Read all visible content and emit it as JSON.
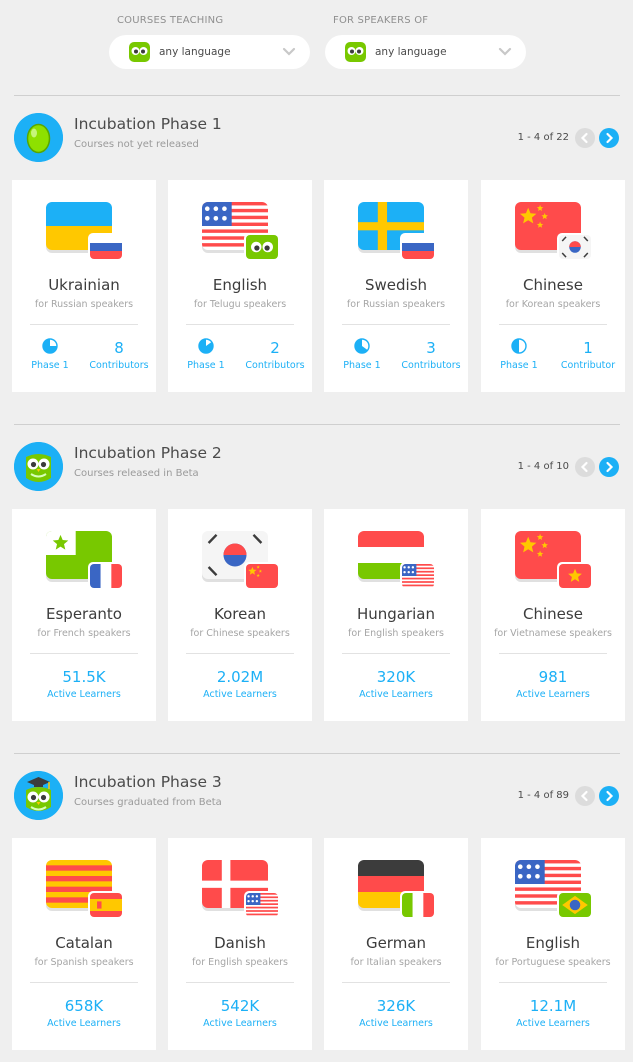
{
  "filters": {
    "teaching": {
      "label": "COURSES TEACHING",
      "value": "any language"
    },
    "speakers": {
      "label": "FOR SPEAKERS OF",
      "value": "any language"
    }
  },
  "colors": {
    "accent": "#1cb0f6",
    "owl_green": "#78c800",
    "pager_disabled": "#dcdcdc"
  },
  "sections": [
    {
      "title": "Incubation Phase 1",
      "subtitle": "Courses not yet released",
      "pager": "1 - 4 of 22",
      "icon": "egg-icon",
      "cards": [
        {
          "language": "Ukrainian",
          "for": "for Russian speakers",
          "flag": "ukraine",
          "badge": "russia",
          "phase_label": "Phase 1",
          "phase_progress": 0.25,
          "count": "8",
          "count_label": "Contributors"
        },
        {
          "language": "English",
          "for": "for Telugu speakers",
          "flag": "usa",
          "badge": "owl",
          "phase_label": "Phase 1",
          "phase_progress": 0.15,
          "count": "2",
          "count_label": "Contributors"
        },
        {
          "language": "Swedish",
          "for": "for Russian speakers",
          "flag": "sweden",
          "badge": "russia",
          "phase_label": "Phase 1",
          "phase_progress": 0.35,
          "count": "3",
          "count_label": "Contributors"
        },
        {
          "language": "Chinese",
          "for": "for Korean speakers",
          "flag": "china",
          "badge": "korea",
          "phase_label": "Phase 1",
          "phase_progress": 0.5,
          "count": "1",
          "count_label": "Contributor"
        }
      ]
    },
    {
      "title": "Incubation Phase 2",
      "subtitle": "Courses released in Beta",
      "pager": "1 - 4 of 10",
      "icon": "owl-icon",
      "cards": [
        {
          "language": "Esperanto",
          "for": "for French speakers",
          "flag": "esperanto",
          "badge": "france",
          "count": "51.5K",
          "count_label": "Active Learners"
        },
        {
          "language": "Korean",
          "for": "for Chinese speakers",
          "flag": "korea",
          "badge": "china",
          "count": "2.02M",
          "count_label": "Active Learners"
        },
        {
          "language": "Hungarian",
          "for": "for English speakers",
          "flag": "hungary",
          "badge": "usa",
          "count": "320K",
          "count_label": "Active Learners"
        },
        {
          "language": "Chinese",
          "for": "for Vietnamese speakers",
          "flag": "china",
          "badge": "vietnam",
          "count": "981",
          "count_label": "Active Learners"
        }
      ]
    },
    {
      "title": "Incubation Phase 3",
      "subtitle": "Courses graduated from Beta",
      "pager": "1 - 4 of 89",
      "icon": "graduate-owl-icon",
      "cards": [
        {
          "language": "Catalan",
          "for": "for Spanish speakers",
          "flag": "catalonia",
          "badge": "spain",
          "count": "658K",
          "count_label": "Active Learners"
        },
        {
          "language": "Danish",
          "for": "for English speakers",
          "flag": "denmark",
          "badge": "usa",
          "count": "542K",
          "count_label": "Active Learners"
        },
        {
          "language": "German",
          "for": "for Italian speakers",
          "flag": "germany",
          "badge": "italy",
          "count": "326K",
          "count_label": "Active Learners"
        },
        {
          "language": "English",
          "for": "for Portuguese speakers",
          "flag": "usa",
          "badge": "brazil",
          "count": "12.1M",
          "count_label": "Active Learners"
        }
      ]
    }
  ]
}
